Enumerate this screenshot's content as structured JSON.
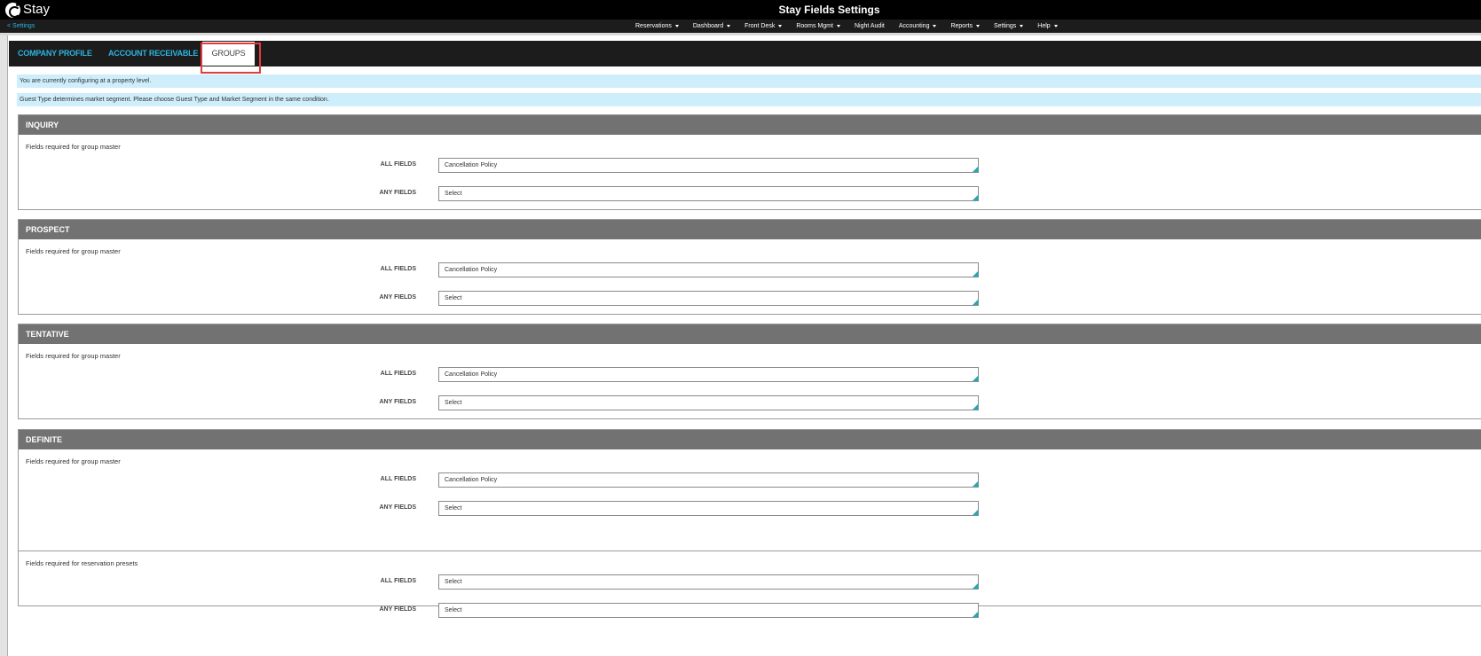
{
  "app": {
    "logo_text": "Stay",
    "title": "Stay Fields Settings"
  },
  "nav": {
    "back_link": "< Settings",
    "menu": [
      {
        "label": "Reservations",
        "has_caret": true
      },
      {
        "label": "Dashboard",
        "has_caret": true
      },
      {
        "label": "Front Desk",
        "has_caret": true
      },
      {
        "label": "Rooms Mgmt",
        "has_caret": true
      },
      {
        "label": "Night Audit",
        "has_caret": false
      },
      {
        "label": "Accounting",
        "has_caret": true
      },
      {
        "label": "Reports",
        "has_caret": true
      },
      {
        "label": "Settings",
        "has_caret": true
      },
      {
        "label": "Help",
        "has_caret": true
      }
    ]
  },
  "tabs": {
    "company_profile": "COMPANY PROFILE",
    "account_receivable": "ACCOUNT RECEIVABLE",
    "groups": "GROUPS",
    "active": "groups"
  },
  "info": {
    "level_notice": "You are currently configuring at a property level.",
    "guest_type_notice": "Guest Type determines market segment. Please choose Guest Type and Market Segment in the same condition."
  },
  "labels": {
    "all_fields": "ALL FIELDS",
    "any_fields": "ANY FIELDS"
  },
  "sections": {
    "inquiry": {
      "title": "INQUIRY",
      "group_master": {
        "label": "Fields required for group master",
        "all_fields": "Cancellation Policy",
        "any_fields": "Select"
      }
    },
    "prospect": {
      "title": "PROSPECT",
      "group_master": {
        "label": "Fields required for group master",
        "all_fields": "Cancellation Policy",
        "any_fields": "Select"
      }
    },
    "tentative": {
      "title": "TENTATIVE",
      "group_master": {
        "label": "Fields required for group master",
        "all_fields": "Cancellation Policy",
        "any_fields": "Select"
      }
    },
    "definite": {
      "title": "DEFINITE",
      "group_master": {
        "label": "Fields required for group master",
        "all_fields": "Cancellation Policy",
        "any_fields": "Select"
      },
      "reservation_presets": {
        "label": "Fields required for reservation presets",
        "all_fields": "Select",
        "any_fields": "Select"
      }
    }
  },
  "colors": {
    "accent": "#2bb4e0",
    "header_bg": "#000000",
    "section_header": "#727272",
    "info_bg": "#cdeefa",
    "highlight": "#e23c3c",
    "select_corner": "#1eaab8"
  }
}
